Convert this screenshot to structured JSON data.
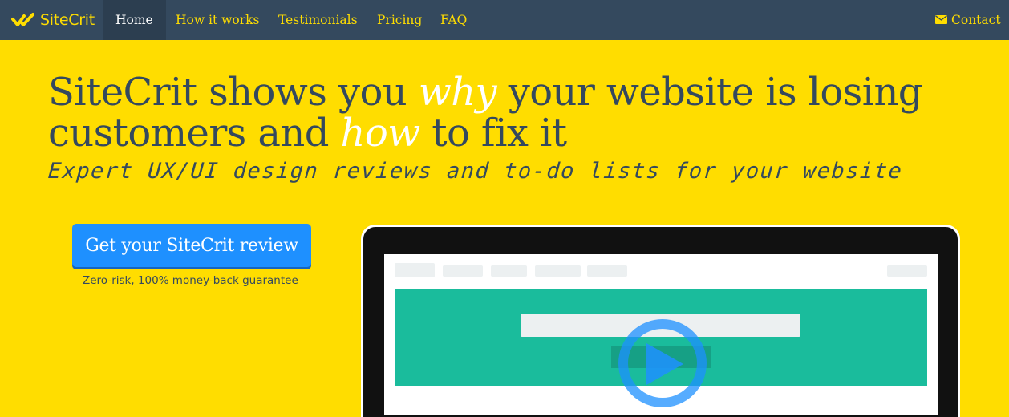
{
  "nav": {
    "brand": "SiteCrit",
    "items": [
      {
        "label": "Home",
        "active": true
      },
      {
        "label": "How it works"
      },
      {
        "label": "Testimonials"
      },
      {
        "label": "Pricing"
      },
      {
        "label": "FAQ"
      }
    ],
    "contact_label": "Contact",
    "contact_icon": "envelope-icon",
    "brand_icon": "check-logo-icon"
  },
  "hero": {
    "headline_part1": "SiteCrit shows you ",
    "headline_emph1": "why",
    "headline_part2": " your website is losing customers and ",
    "headline_emph2": "how",
    "headline_part3": " to fix it",
    "tagline": "Expert UX/UI design reviews and to-do lists for your website",
    "cta_label": "Get your SiteCrit review",
    "guarantee": "Zero-risk, 100% money-back guarantee"
  },
  "video": {
    "play_icon": "play-icon"
  },
  "colors": {
    "background": "#ffdd00",
    "nav_bg": "#34495e",
    "nav_active_bg": "#2c3e50",
    "text_dark": "#34495e",
    "cta_blue": "#1e90ff",
    "screen_green": "#1abc9c"
  }
}
